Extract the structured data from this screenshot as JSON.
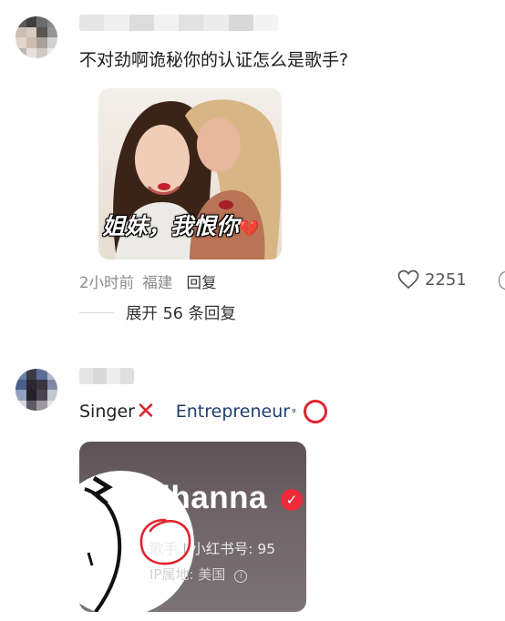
{
  "comment1": {
    "avatar_label": "blurred-avatar",
    "text": "不对劲啊诡秘你的认证怎么是歌手?",
    "image_caption": "姐妹，我恨你",
    "time": "2小时前",
    "location": "福建",
    "reply_label": "回复",
    "like_count": "2251",
    "expand_label": "展开 56 条回复"
  },
  "comment2": {
    "avatar_label": "blurred-avatar",
    "word_singer": "Singer",
    "word_entrepreneur": "Entrepreneur",
    "search_glyph": "ᵠ",
    "profile": {
      "name": "rihanna",
      "tag": "歌手",
      "id_label": "小红书号: 95",
      "ip_label": "IP属地: 美国"
    }
  },
  "colors": {
    "accent_red": "#e0242f",
    "link_blue": "#1f3e6e",
    "meta_gray": "#8a8a8a"
  }
}
